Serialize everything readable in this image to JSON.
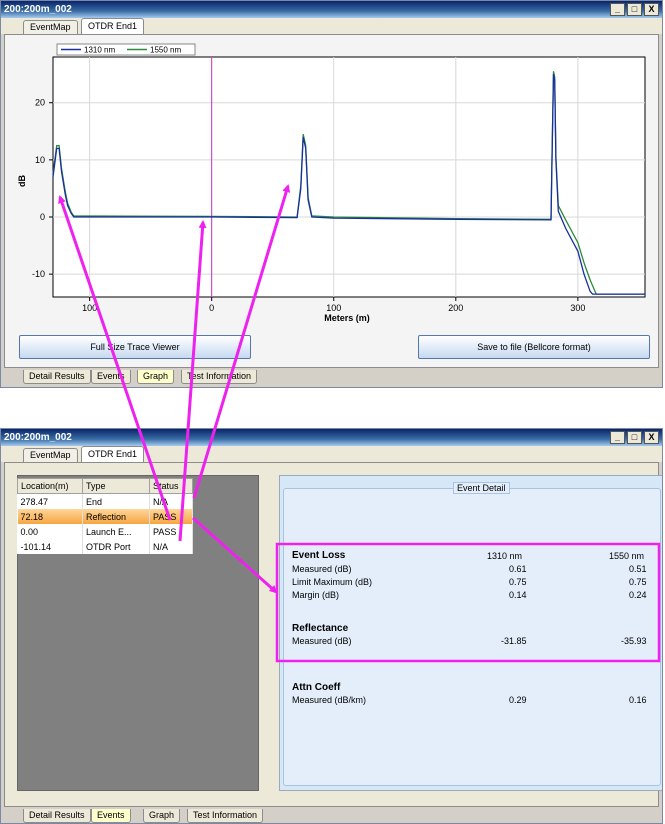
{
  "top_window": {
    "title": "200:200m_002",
    "controls": [
      "_",
      "□",
      "X"
    ],
    "tabs": [
      "EventMap",
      "OTDR End1"
    ],
    "active_tab": "OTDR End1",
    "buttons": {
      "full_size": "Full Size Trace Viewer",
      "save": "Save to file (Bellcore format)"
    },
    "bottom_tabs": [
      "Detail Results",
      "Events",
      "Graph",
      "Test Information"
    ],
    "active_bottom_tab": "Graph"
  },
  "chart_data": {
    "type": "line",
    "xlabel": "Meters (m)",
    "ylabel": "dB",
    "xlim": [
      -130,
      355
    ],
    "ylim": [
      -14,
      28
    ],
    "x_ticks": [
      -100,
      0,
      100,
      200,
      300
    ],
    "x_tick_labels": [
      "100",
      "0",
      "100",
      "200",
      "300"
    ],
    "y_ticks": [
      20,
      10,
      0,
      -10
    ],
    "y_tick_labels": [
      "20",
      "10",
      "0",
      "-10"
    ],
    "cursor_x": 0,
    "legend": "top-left",
    "series": [
      {
        "name": "1310 nm",
        "color": "#1a2f9e",
        "x": [
          -130,
          -127,
          -125,
          -123,
          -120,
          -118,
          -115,
          -113,
          0,
          70,
          73,
          75,
          77,
          79,
          82,
          100,
          200,
          278,
          279,
          280,
          281,
          282,
          284,
          290,
          300,
          305,
          310,
          312,
          330,
          355
        ],
        "y": [
          7,
          12,
          12,
          8,
          4,
          2,
          0.6,
          0,
          0,
          -0.1,
          5,
          14,
          12,
          3,
          0,
          -0.2,
          -0.4,
          -0.5,
          12,
          25,
          24,
          10,
          1,
          -2,
          -6,
          -10,
          -13,
          -13.5,
          -13.5,
          -13.5
        ]
      },
      {
        "name": "1550 nm",
        "color": "#2a8a3a",
        "x": [
          -130,
          -127,
          -125,
          -123,
          -120,
          -118,
          -115,
          -113,
          0,
          70,
          73,
          75,
          77,
          79,
          82,
          100,
          200,
          278,
          279,
          280,
          281,
          282,
          284,
          290,
          300,
          305,
          310,
          315,
          330,
          355
        ],
        "y": [
          7.5,
          12.5,
          12.5,
          8.5,
          4.5,
          2.4,
          0.8,
          0.2,
          0.1,
          0,
          5.5,
          14.5,
          12.5,
          3.4,
          0.2,
          0,
          -0.3,
          -0.4,
          12.5,
          25.5,
          24.5,
          10.5,
          2,
          -0.5,
          -4.5,
          -8,
          -11,
          -13.5,
          -13.5,
          -13.5
        ]
      }
    ]
  },
  "bottom_window": {
    "title": "200:200m_002",
    "controls": [
      "_",
      "□",
      "X"
    ],
    "tabs": [
      "EventMap",
      "OTDR End1"
    ],
    "active_tab": "OTDR End1",
    "table": {
      "headers": [
        "Location(m)",
        "Type",
        "Status"
      ],
      "rows": [
        [
          "278.47",
          "End",
          "N/A"
        ],
        [
          "72.18",
          "Reflection",
          "PASS"
        ],
        [
          "0.00",
          "Launch E...",
          "PASS"
        ],
        [
          "-101.14",
          "OTDR Port",
          "N/A"
        ]
      ],
      "selected_row": 1
    },
    "detail": {
      "group_title": "Event Detail",
      "event_loss": {
        "title": "Event Loss",
        "col1": "1310 nm",
        "col2": "1550 nm",
        "rows": [
          {
            "label": "Measured (dB)",
            "v1": "0.61",
            "v2": "0.51"
          },
          {
            "label": "Limit Maximum (dB)",
            "v1": "0.75",
            "v2": "0.75"
          },
          {
            "label": "Margin (dB)",
            "v1": "0.14",
            "v2": "0.24"
          }
        ]
      },
      "reflectance": {
        "title": "Reflectance",
        "label": "Measured (dB)",
        "v1": "-31.85",
        "v2": "-35.93"
      },
      "attn": {
        "title": "Attn Coeff",
        "label": "Measured (dB/km)",
        "v1": "0.29",
        "v2": "0.16"
      }
    },
    "bottom_tabs": [
      "Detail Results",
      "Events",
      "Graph",
      "Test Information"
    ],
    "active_bottom_tab": "Events"
  },
  "annotation_color": "#ee22ee"
}
